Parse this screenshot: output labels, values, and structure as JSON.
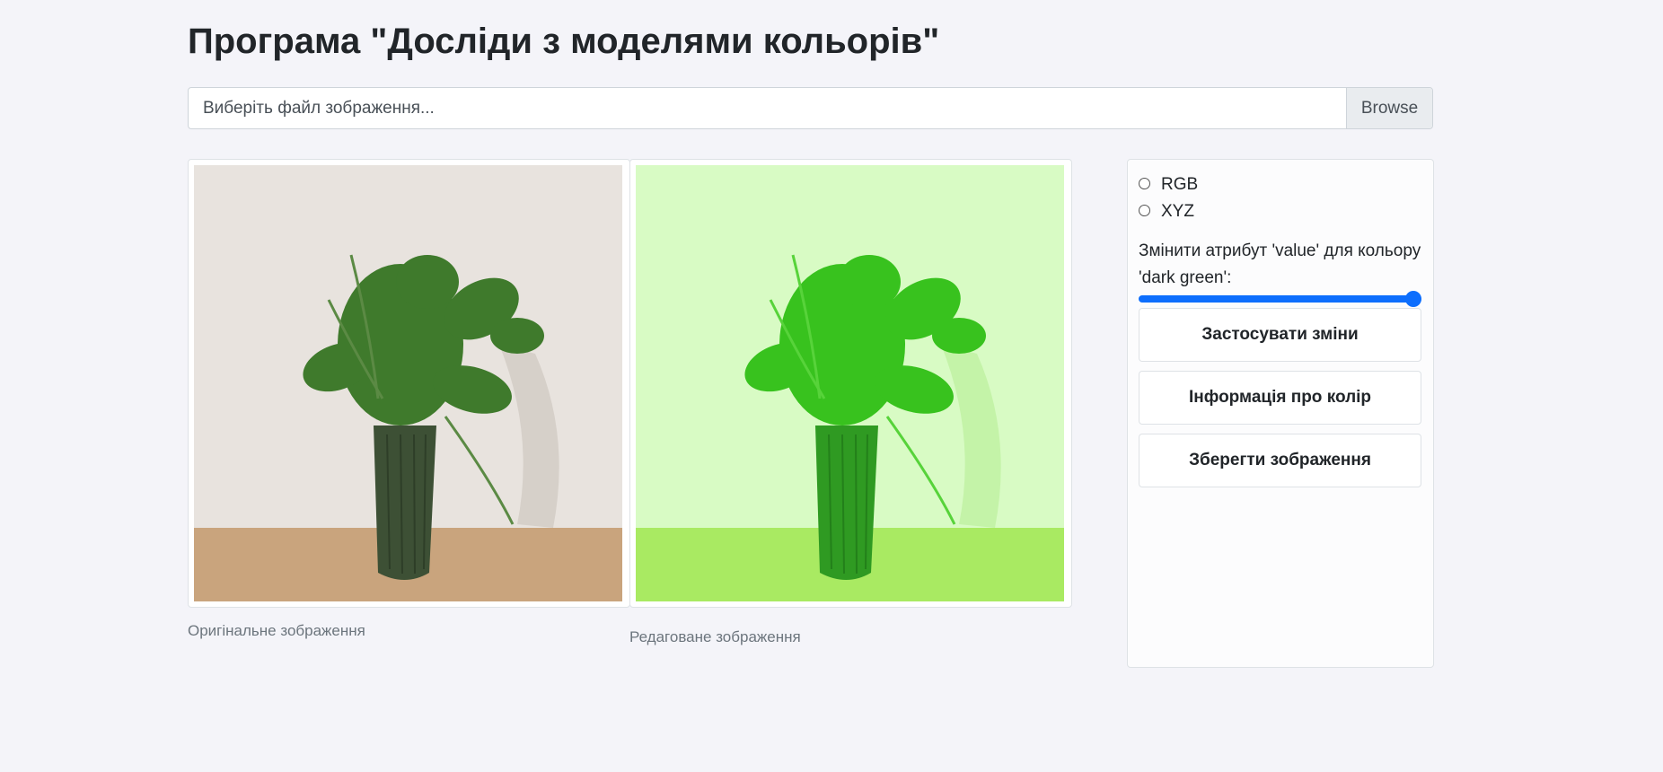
{
  "page": {
    "title": "Програма \"Досліди з моделями кольорів\""
  },
  "file_input": {
    "label": "Виберіть файл зображення...",
    "browse_label": "Browse"
  },
  "images": {
    "original_caption": "Оригінальне зображення",
    "edited_caption": "Редаговане зображення"
  },
  "controls": {
    "color_models": [
      {
        "label": "RGB",
        "selected": false
      },
      {
        "label": "XYZ",
        "selected": false
      }
    ],
    "slider_label": "Змінити атрибут 'value' для кольору 'dark green':",
    "slider_value_fraction": 1.0,
    "apply_label": "Застосувати зміни",
    "info_label": "Інформація про колір",
    "save_label": "Зберегти зображення"
  },
  "colors": {
    "accent": "#0d6efd",
    "original_wall": "#e8e3de",
    "original_table": "#c9a47d",
    "edited_wall": "#d8fbc4",
    "edited_table": "#a9ea62",
    "original_leaf": "#3f7a2c",
    "edited_leaf": "#38c21e"
  }
}
